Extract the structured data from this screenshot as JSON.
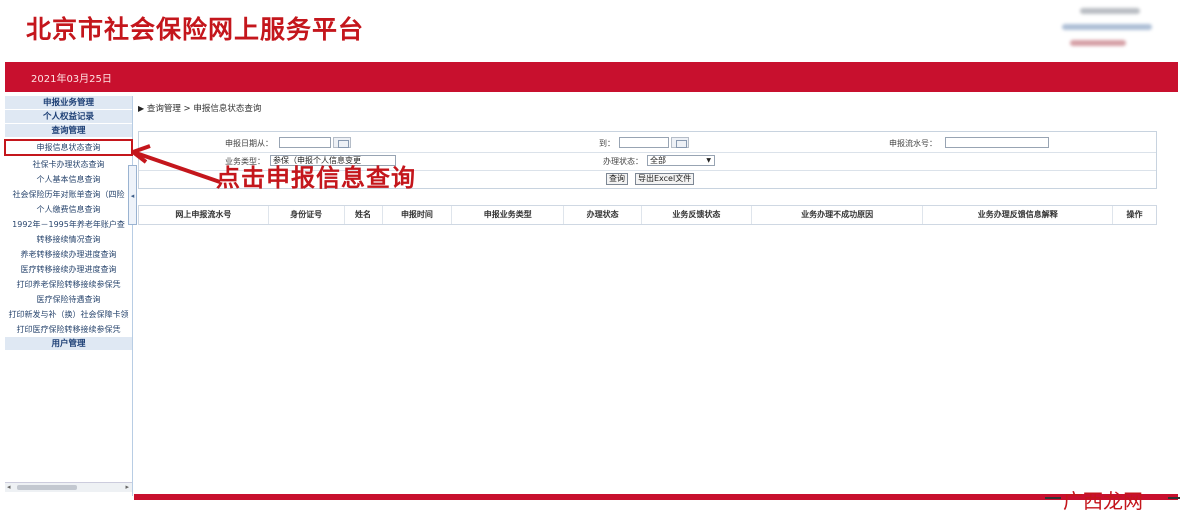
{
  "header": {
    "site_title": "北京市社会保险网上服务平台"
  },
  "redbar": {
    "date": "2021年03月25日"
  },
  "sidebar": {
    "sections": [
      {
        "label": "申报业务管理"
      },
      {
        "label": "个人权益记录"
      },
      {
        "label": "查询管理"
      }
    ],
    "items": [
      {
        "label": "申报信息状态查询"
      },
      {
        "label": "社保卡办理状态查询"
      },
      {
        "label": "个人基本信息查询"
      },
      {
        "label": "社会保险历年对账单查询（四险"
      },
      {
        "label": "个人缴费信息查询"
      },
      {
        "label": "1992年－1995年养老年账户查"
      },
      {
        "label": "转移接续情况查询"
      },
      {
        "label": "养老转移接续办理进度查询"
      },
      {
        "label": "医疗转移接续办理进度查询"
      },
      {
        "label": "打印养老保险转移接续参保凭"
      },
      {
        "label": "医疗保险待遇查询"
      },
      {
        "label": "打印新发与补（换）社会保障卡领"
      },
      {
        "label": "打印医疗保险转移接续参保凭"
      }
    ],
    "user_section": "用户管理"
  },
  "main": {
    "breadcrumb": "查询管理 > 申报信息状态查询",
    "form": {
      "date_from_label": "申报日期从：",
      "date_to_label": "到：",
      "serial_label": "申报流水号：",
      "biz_type_label": "业务类型：",
      "biz_type_value": "参保（申报个人信息变更",
      "status_label": "办理状态：",
      "status_value": "全部",
      "query_btn": "查询",
      "export_btn": "导出Excel文件"
    },
    "table_headers": [
      "网上申报流水号",
      "身份证号",
      "姓名",
      "申报时间",
      "申报业务类型",
      "办理状态",
      "业务反馈状态",
      "业务办理不成功原因",
      "业务办理反馈信息解释",
      "操作"
    ]
  },
  "annotation": {
    "text": "点击申报信息查询"
  },
  "watermark": {
    "text": "广西龙网"
  },
  "colors": {
    "brand_red": "#c8102e",
    "sidebar_text": "#29466e"
  }
}
